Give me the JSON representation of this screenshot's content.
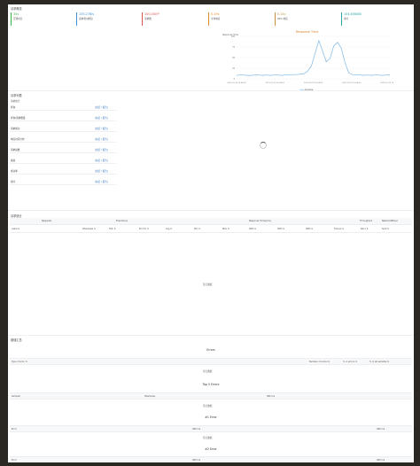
{
  "overview": {
    "title": "请求概览",
    "cards": [
      {
        "value": "35",
        "unit": "s",
        "label": "压测时长",
        "color": "#3ab54a"
      },
      {
        "value": "135,278",
        "unit": "/s",
        "label": "请求/秒(峰值)",
        "color": "#3b8fd6"
      },
      {
        "value": "100,000",
        "unit": "个",
        "label": "请求数",
        "color": "#d9534f"
      },
      {
        "value": "0.19",
        "unit": "s",
        "label": "平均响应",
        "color": "#e08a2a"
      },
      {
        "value": "0.15",
        "unit": "s",
        "label": "90% 响应",
        "color": "#c59340"
      },
      {
        "value": "104,858",
        "unit": "/KB",
        "label": "吞吐",
        "color": "#2aa3a3"
      }
    ]
  },
  "chart_data": {
    "type": "line",
    "title": "Response Time",
    "ylabel": "Response Time",
    "ylim": [
      0,
      100
    ],
    "y_ticks": [
      "100",
      "75",
      "50",
      "25",
      "0"
    ],
    "x_ticks": [
      "2021-10-13 15:54:00",
      "2021-10-13 15:54:01",
      "2021-10-13 15:54:02",
      "2021-10-13 15:54:03",
      "2021-10-13 15:54:04"
    ],
    "series": [
      {
        "name": "Average",
        "color": "#7cb8e8",
        "values": [
          8,
          9,
          9,
          8,
          8,
          9,
          9,
          8,
          9,
          8,
          9,
          9,
          8,
          9,
          9,
          10,
          10,
          11,
          12,
          18,
          30,
          60,
          90,
          65,
          40,
          48,
          78,
          86,
          72,
          38,
          14,
          10,
          9,
          9,
          8,
          9,
          8,
          9,
          9,
          8,
          9,
          9
        ]
      }
    ],
    "legend_placement": "bottom"
  },
  "requests": {
    "title": "请求列表",
    "subtitle": "请求统计",
    "items": [
      {
        "name": "查询",
        "link": "[总结 / 报告]"
      },
      {
        "name": "查询/请求数量",
        "link": "[总结 / 报告]"
      },
      {
        "name": "请求成功",
        "link": "[总结 / 报告]"
      },
      {
        "name": "响应时间分布",
        "link": "[总结 / 报告]"
      },
      {
        "name": "请求总数",
        "link": "[总结 / 报告]"
      },
      {
        "name": "失败",
        "link": "[总结 / 报告]"
      },
      {
        "name": "成功率",
        "link": "[总结 / 报告]"
      },
      {
        "name": "吞吐",
        "link": "[总结 / 报告]"
      }
    ]
  },
  "stats_table": {
    "title": "请求统计",
    "group_headers": [
      "Requests",
      "Executions",
      "Response Times(ms)",
      "Throughput",
      "NetworkKB/sec"
    ],
    "columns": [
      "Label ⇅",
      "#Samples ⇅",
      "FAIL ⇅",
      "Error% ⇅",
      "Avg ⇅",
      "Min ⇅",
      "Max ⇅",
      "90th ⇅",
      "95th ⇅",
      "99th ⇅",
      "Trans/s ⇅",
      "Recv ⇅",
      "Sent ⇅"
    ],
    "empty_text": "暂无数据"
  },
  "errors": {
    "title": "错误汇总",
    "errors_heading": "Errors",
    "type_col": "Type of error ⇅",
    "num_col": "Number of errors ⇅",
    "pct_col": "% in errors ⇅",
    "pct_all_col": "% in all samples ⇅",
    "empty_text": "暂无数据",
    "top5_heading": "Top 5 Errors",
    "sample_col": "Sampler",
    "samples_col": "#Samples",
    "errors_col": "#Errors",
    "error1_heading": "#1 Error",
    "error2_heading": "#2 Error",
    "error_col": "Error"
  }
}
